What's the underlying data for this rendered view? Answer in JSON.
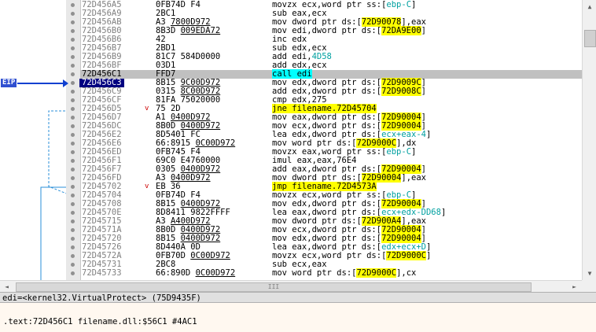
{
  "eip_label": "EIP",
  "rows": [
    {
      "addr": "72D456A5",
      "bytes": [
        [
          "0FB74D F4",
          false
        ]
      ],
      "instr": [
        [
          "movzx ecx,word ptr ss:[",
          ""
        ],
        [
          "ebp-C",
          "cy"
        ],
        [
          "]",
          ""
        ]
      ],
      "sym": ""
    },
    {
      "addr": "72D456A9",
      "bytes": [
        [
          "2BC1",
          false
        ]
      ],
      "instr": [
        [
          "sub eax,ecx",
          ""
        ]
      ],
      "sym": ""
    },
    {
      "addr": "72D456AB",
      "bytes": [
        [
          "A3 ",
          false
        ],
        [
          "7800D972",
          true
        ]
      ],
      "instr": [
        [
          "mov dword ptr ds:[",
          ""
        ],
        [
          "72D90078",
          "hl"
        ],
        [
          "],eax",
          ""
        ]
      ],
      "sym": ""
    },
    {
      "addr": "72D456B0",
      "bytes": [
        [
          "8B3D ",
          false
        ],
        [
          "009EDA72",
          true
        ]
      ],
      "instr": [
        [
          "mov edi,dword ptr ds:[",
          ""
        ],
        [
          "72DA9E00",
          "hl"
        ],
        [
          "]",
          ""
        ]
      ],
      "sym": ""
    },
    {
      "addr": "72D456B6",
      "bytes": [
        [
          "42",
          false
        ]
      ],
      "instr": [
        [
          "inc edx",
          ""
        ]
      ],
      "sym": ""
    },
    {
      "addr": "72D456B7",
      "bytes": [
        [
          "2BD1",
          false
        ]
      ],
      "instr": [
        [
          "sub edx,ecx",
          ""
        ]
      ],
      "sym": ""
    },
    {
      "addr": "72D456B9",
      "bytes": [
        [
          "81C7 584D0000",
          false
        ]
      ],
      "instr": [
        [
          "add edi,",
          ""
        ],
        [
          "4D58",
          "cy"
        ]
      ],
      "sym": ""
    },
    {
      "addr": "72D456BF",
      "bytes": [
        [
          "03D1",
          false
        ]
      ],
      "instr": [
        [
          "add edx,ecx",
          ""
        ]
      ],
      "sym": ""
    },
    {
      "addr": "72D456C1",
      "bytes": [
        [
          "FFD7",
          false
        ]
      ],
      "instr": [
        [
          "call edi",
          "callhl"
        ]
      ],
      "sym": "",
      "cur": true
    },
    {
      "addr": "72D456C3",
      "bytes": [
        [
          "8B15 ",
          false
        ],
        [
          "9C00D972",
          true
        ]
      ],
      "instr": [
        [
          "mov edx,dword ptr ds:[",
          ""
        ],
        [
          "72D9009C",
          "hl"
        ],
        [
          "]",
          ""
        ]
      ],
      "sym": "",
      "eip": true
    },
    {
      "addr": "72D456C9",
      "bytes": [
        [
          "0315 ",
          false
        ],
        [
          "8C00D972",
          true
        ]
      ],
      "instr": [
        [
          "add edx,dword ptr ds:[",
          ""
        ],
        [
          "72D9008C",
          "hl"
        ],
        [
          "]",
          ""
        ]
      ],
      "sym": ""
    },
    {
      "addr": "72D456CF",
      "bytes": [
        [
          "81FA 75020000",
          false
        ]
      ],
      "instr": [
        [
          "cmp edx,275",
          ""
        ]
      ],
      "sym": ""
    },
    {
      "addr": "72D456D5",
      "bytes": [
        [
          "75 2D",
          false
        ]
      ],
      "instr": [
        [
          "jne filename.72D45704",
          "jmp"
        ]
      ],
      "sym": "v"
    },
    {
      "addr": "72D456D7",
      "bytes": [
        [
          "A1 ",
          false
        ],
        [
          "0400D972",
          true
        ]
      ],
      "instr": [
        [
          "mov eax,dword ptr ds:[",
          ""
        ],
        [
          "72D90004",
          "hl"
        ],
        [
          "]",
          ""
        ]
      ],
      "sym": ""
    },
    {
      "addr": "72D456DC",
      "bytes": [
        [
          "8B0D ",
          false
        ],
        [
          "0400D972",
          true
        ]
      ],
      "instr": [
        [
          "mov ecx,dword ptr ds:[",
          ""
        ],
        [
          "72D90004",
          "hl"
        ],
        [
          "]",
          ""
        ]
      ],
      "sym": ""
    },
    {
      "addr": "72D456E2",
      "bytes": [
        [
          "8D5401 FC",
          false
        ]
      ],
      "instr": [
        [
          "lea edx,dword ptr ds:[",
          ""
        ],
        [
          "ecx+eax-4",
          "cy"
        ],
        [
          "]",
          ""
        ]
      ],
      "sym": ""
    },
    {
      "addr": "72D456E6",
      "bytes": [
        [
          "66:8915 ",
          false
        ],
        [
          "0C00D972",
          true
        ]
      ],
      "instr": [
        [
          "mov word ptr ds:[",
          ""
        ],
        [
          "72D9000C",
          "hl"
        ],
        [
          "],dx",
          ""
        ]
      ],
      "sym": ""
    },
    {
      "addr": "72D456ED",
      "bytes": [
        [
          "0FB745 F4",
          false
        ]
      ],
      "instr": [
        [
          "movzx eax,word ptr ss:[",
          ""
        ],
        [
          "ebp-C",
          "cy"
        ],
        [
          "]",
          ""
        ]
      ],
      "sym": ""
    },
    {
      "addr": "72D456F1",
      "bytes": [
        [
          "69C0 E4760000",
          false
        ]
      ],
      "instr": [
        [
          "imul eax,eax,76E4",
          ""
        ]
      ],
      "sym": ""
    },
    {
      "addr": "72D456F7",
      "bytes": [
        [
          "0305 ",
          false
        ],
        [
          "0400D972",
          true
        ]
      ],
      "instr": [
        [
          "add eax,dword ptr ds:[",
          ""
        ],
        [
          "72D90004",
          "hl"
        ],
        [
          "]",
          ""
        ]
      ],
      "sym": ""
    },
    {
      "addr": "72D456FD",
      "bytes": [
        [
          "A3 ",
          false
        ],
        [
          "0400D972",
          true
        ]
      ],
      "instr": [
        [
          "mov dword ptr ds:[",
          ""
        ],
        [
          "72D90004",
          "hl"
        ],
        [
          "],eax",
          ""
        ]
      ],
      "sym": ""
    },
    {
      "addr": "72D45702",
      "bytes": [
        [
          "EB 36",
          false
        ]
      ],
      "instr": [
        [
          "jmp filename.72D4573A",
          "jmp"
        ]
      ],
      "sym": "v"
    },
    {
      "addr": "72D45704",
      "bytes": [
        [
          "0FB74D F4",
          false
        ]
      ],
      "instr": [
        [
          "movzx ecx,word ptr ss:[",
          ""
        ],
        [
          "ebp-C",
          "cy"
        ],
        [
          "]",
          ""
        ]
      ],
      "sym": ""
    },
    {
      "addr": "72D45708",
      "bytes": [
        [
          "8B15 ",
          false
        ],
        [
          "0400D972",
          true
        ]
      ],
      "instr": [
        [
          "mov edx,dword ptr ds:[",
          ""
        ],
        [
          "72D90004",
          "hl"
        ],
        [
          "]",
          ""
        ]
      ],
      "sym": ""
    },
    {
      "addr": "72D4570E",
      "bytes": [
        [
          "8D8411 9822FFFF",
          false
        ]
      ],
      "instr": [
        [
          "lea eax,dword ptr ds:[",
          ""
        ],
        [
          "ecx+edx-DD68",
          "cy"
        ],
        [
          "]",
          ""
        ]
      ],
      "sym": ""
    },
    {
      "addr": "72D45715",
      "bytes": [
        [
          "A3 ",
          false
        ],
        [
          "A400D972",
          true
        ]
      ],
      "instr": [
        [
          "mov dword ptr ds:[",
          ""
        ],
        [
          "72D900A4",
          "hl"
        ],
        [
          "],eax",
          ""
        ]
      ],
      "sym": ""
    },
    {
      "addr": "72D4571A",
      "bytes": [
        [
          "8B0D ",
          false
        ],
        [
          "0400D972",
          true
        ]
      ],
      "instr": [
        [
          "mov ecx,dword ptr ds:[",
          ""
        ],
        [
          "72D90004",
          "hl"
        ],
        [
          "]",
          ""
        ]
      ],
      "sym": ""
    },
    {
      "addr": "72D45720",
      "bytes": [
        [
          "8B15 ",
          false
        ],
        [
          "0400D972",
          true
        ]
      ],
      "instr": [
        [
          "mov edx,dword ptr ds:[",
          ""
        ],
        [
          "72D90004",
          "hl"
        ],
        [
          "]",
          ""
        ]
      ],
      "sym": ""
    },
    {
      "addr": "72D45726",
      "bytes": [
        [
          "8D440A 0D",
          false
        ]
      ],
      "instr": [
        [
          "lea eax,dword ptr ds:[",
          ""
        ],
        [
          "edx+ecx+D",
          "cy"
        ],
        [
          "]",
          ""
        ]
      ],
      "sym": ""
    },
    {
      "addr": "72D4572A",
      "bytes": [
        [
          "0FB70D ",
          false
        ],
        [
          "0C00D972",
          true
        ]
      ],
      "instr": [
        [
          "movzx ecx,word ptr ds:[",
          ""
        ],
        [
          "72D9000C",
          "hl"
        ],
        [
          "]",
          ""
        ]
      ],
      "sym": ""
    },
    {
      "addr": "72D45731",
      "bytes": [
        [
          "2BC8",
          false
        ]
      ],
      "instr": [
        [
          "sub ecx,eax",
          ""
        ]
      ],
      "sym": ""
    },
    {
      "addr": "72D45733",
      "bytes": [
        [
          "66:890D ",
          false
        ],
        [
          "0C00D972",
          true
        ]
      ],
      "instr": [
        [
          "mov word ptr ds:[",
          ""
        ],
        [
          "72D9000C",
          "hl"
        ],
        [
          "],cx",
          ""
        ]
      ],
      "sym": ""
    }
  ],
  "info_bar": "edi=<kernel32.VirtualProtect> (75D9435F)",
  "address_line": ".text:72D456C1 filename.dll:$56C1 #4AC1",
  "scroll": {
    "up": "▲",
    "down": "▼",
    "left": "◄",
    "right": "►",
    "grip": "III"
  }
}
